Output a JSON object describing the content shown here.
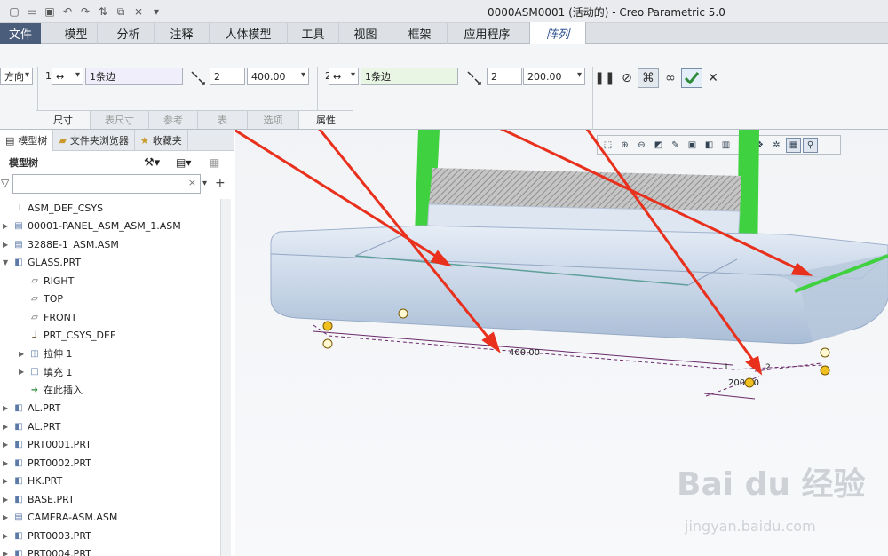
{
  "window": {
    "title": "0000ASM0001 (活动的) - Creo Parametric 5.0"
  },
  "tabs": [
    {
      "label": "文件",
      "file": true
    },
    {
      "label": "模型"
    },
    {
      "label": "分析"
    },
    {
      "label": "注释"
    },
    {
      "label": "人体模型"
    },
    {
      "label": "工具"
    },
    {
      "label": "视图"
    },
    {
      "label": "框架"
    },
    {
      "label": "应用程序"
    },
    {
      "label": "阵列",
      "active": true
    }
  ],
  "dashboard": {
    "type_select": "方向",
    "dir1": {
      "index": "1",
      "arrows": "↔",
      "ref": "1条边",
      "count": "2",
      "spacing": "400.00"
    },
    "dir2": {
      "index": "2",
      "arrows": "↔",
      "ref": "1条边",
      "count": "2",
      "spacing": "200.00"
    },
    "subtabs": [
      "尺寸",
      "表尺寸",
      "参考",
      "表",
      "选项",
      "属性"
    ],
    "ref1_bg": "#f0eefb",
    "ref2_bg": "#eaf6e4",
    "confirm_color": "#2e8b3a"
  },
  "left_panel": {
    "tabs": [
      "模型树",
      "文件夹浏览器",
      "收藏夹"
    ],
    "header": "模型树",
    "tree": [
      {
        "label": "ASM_DEF_CSYS",
        "icon": "csys-icon",
        "indent": 0,
        "expand": false
      },
      {
        "label": "00001-PANEL_ASM_ASM_1.ASM",
        "icon": "assembly-icon",
        "indent": 0,
        "expand": true
      },
      {
        "label": "3288E-1_ASM.ASM",
        "icon": "assembly-icon",
        "indent": 0,
        "expand": true
      },
      {
        "label": "GLASS.PRT",
        "icon": "part-icon",
        "indent": 0,
        "expand": true,
        "open": true
      },
      {
        "label": "RIGHT",
        "icon": "datum-plane-icon",
        "indent": 1,
        "expand": false
      },
      {
        "label": "TOP",
        "icon": "datum-plane-icon",
        "indent": 1,
        "expand": false
      },
      {
        "label": "FRONT",
        "icon": "datum-plane-icon",
        "indent": 1,
        "expand": false
      },
      {
        "label": "PRT_CSYS_DEF",
        "icon": "csys-icon",
        "indent": 1,
        "expand": false
      },
      {
        "label": "拉伸 1",
        "icon": "extrude-icon",
        "indent": 1,
        "expand": true
      },
      {
        "label": "填充 1",
        "icon": "fill-icon",
        "indent": 1,
        "expand": true
      },
      {
        "label": "在此插入",
        "icon": "insert-arrow-icon",
        "indent": 1,
        "expand": false
      },
      {
        "label": "AL.PRT",
        "icon": "part-icon",
        "indent": 0,
        "expand": true
      },
      {
        "label": "AL.PRT",
        "icon": "part-icon",
        "indent": 0,
        "expand": true
      },
      {
        "label": "PRT0001.PRT",
        "icon": "part-icon",
        "indent": 0,
        "expand": true
      },
      {
        "label": "PRT0002.PRT",
        "icon": "part-icon",
        "indent": 0,
        "expand": true
      },
      {
        "label": "HK.PRT",
        "icon": "part-icon",
        "indent": 0,
        "expand": true
      },
      {
        "label": "BASE.PRT",
        "icon": "part-icon",
        "indent": 0,
        "expand": true
      },
      {
        "label": "CAMERA-ASM.ASM",
        "icon": "assembly-icon",
        "indent": 0,
        "expand": true
      },
      {
        "label": "PRT0003.PRT",
        "icon": "part-icon",
        "indent": 0,
        "expand": true
      },
      {
        "label": "PRT0004.PRT",
        "icon": "part-icon",
        "indent": 0,
        "expand": true
      }
    ]
  },
  "graphics": {
    "dim_400": "400.00",
    "dim_200": "200.00",
    "dim_1": "1",
    "dim_2": "2",
    "arrow_color": "#e8301c",
    "highlight_color": "#3fd13f"
  },
  "watermark": {
    "main": "Bai du 经验",
    "sub": "jingyan.baidu.com"
  }
}
